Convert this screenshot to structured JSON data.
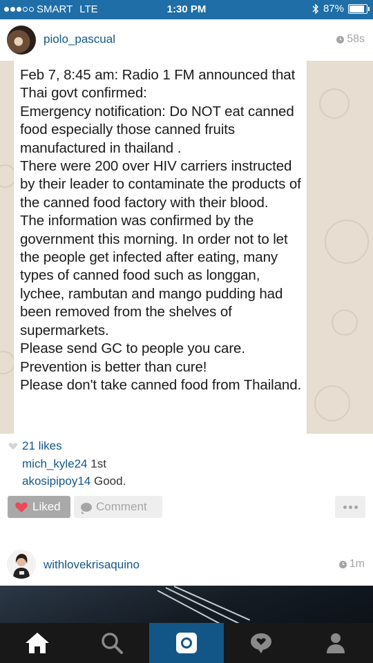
{
  "status_bar": {
    "carrier": "SMART",
    "network": "LTE",
    "time": "1:30 PM",
    "battery": "87%",
    "battery_level": 0.87,
    "signal_bars_filled": 3,
    "signal_bars_total": 5
  },
  "post": {
    "username": "piolo_pascual",
    "time_ago": "58s",
    "message": "Feb 7, 8:45 am:  Radio 1 FM announced that Thai govt confirmed:\nEmergency notification: Do NOT eat canned food especially those canned fruits manufactured in thailand .\nThere were 200 over HIV carriers instructed by their leader to contaminate the products of the canned food factory with their blood.\nThe information was confirmed by the government this morning. In order not to let the people get infected after eating, many types of canned food such as longgan, lychee, rambutan and mango pudding had been removed from the shelves of supermarkets.\nPlease send GC to people you care.\nPrevention is better than cure!\nPlease don't take canned food from Thailand.",
    "likes": "21 likes",
    "comments": [
      {
        "user": "mich_kyle24",
        "text": "1st"
      },
      {
        "user": "akosipipoy14",
        "text": "Good."
      }
    ],
    "liked_label": "Liked",
    "comment_label": "Comment"
  },
  "post2": {
    "username": "withlovekrisaquino",
    "time_ago": "1m"
  },
  "tab_bar": {
    "tabs": [
      "home-icon",
      "search-icon",
      "camera-icon",
      "activity-icon",
      "profile-icon"
    ],
    "active_tab": 2
  },
  "colors": {
    "status_bar": "#1f6ea7",
    "link": "#125688",
    "like_red": "#ed4956",
    "tab_bar": "#181818",
    "tab_active": "#125688"
  }
}
